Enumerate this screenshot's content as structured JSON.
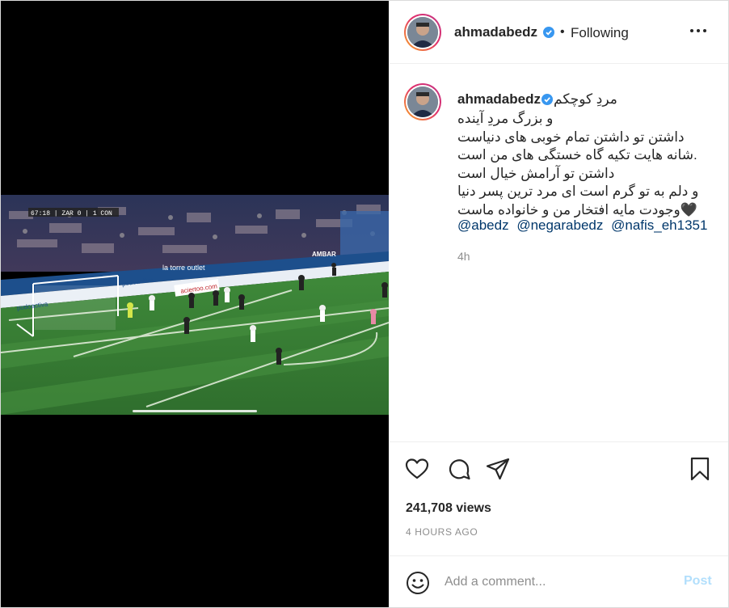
{
  "post": {
    "username": "ahmadabedz",
    "follow_status": "Following",
    "separator": "•"
  },
  "caption": {
    "username": "ahmadabedz",
    "first_line": "مردِ کوچکم",
    "lines": [
      "و بزرگ مردِ آینده",
      "داشتن تو داشتن تمام خوبی های دنیاست",
      ".شانه هایت تکیه گاه خستگی های من است",
      "داشتن تو آرامش خیال است",
      "و دلم به تو گرم است ای مرد ترین پسر دنیا",
      "🖤وجودت مایه افتخار من و خانواده ماست"
    ],
    "mentions": [
      "@abedz",
      "@negarabedz",
      "@nafis_eh1351"
    ],
    "time": "4h"
  },
  "video": {
    "scoreboard": "67:18 | ZAR 0 | 1 CON",
    "banners": [
      "la torre outlet",
      "podoactiva",
      "AMBAR",
      "aciertoo.com"
    ]
  },
  "stats": {
    "views": "241,708 views",
    "time_ago": "4 HOURS AGO"
  },
  "comment": {
    "placeholder": "Add a comment...",
    "post_label": "Post"
  },
  "icons": {
    "more": "more-options-icon",
    "verified": "verified-badge-icon",
    "like": "heart-icon",
    "comment": "comment-icon",
    "share": "share-icon",
    "save": "bookmark-icon",
    "emoji": "emoji-icon"
  },
  "colors": {
    "verified_blue": "#3897f0",
    "mention_blue": "#00376b",
    "post_disabled": "#b2dffc",
    "pitch_green": "#3f8a3a"
  }
}
